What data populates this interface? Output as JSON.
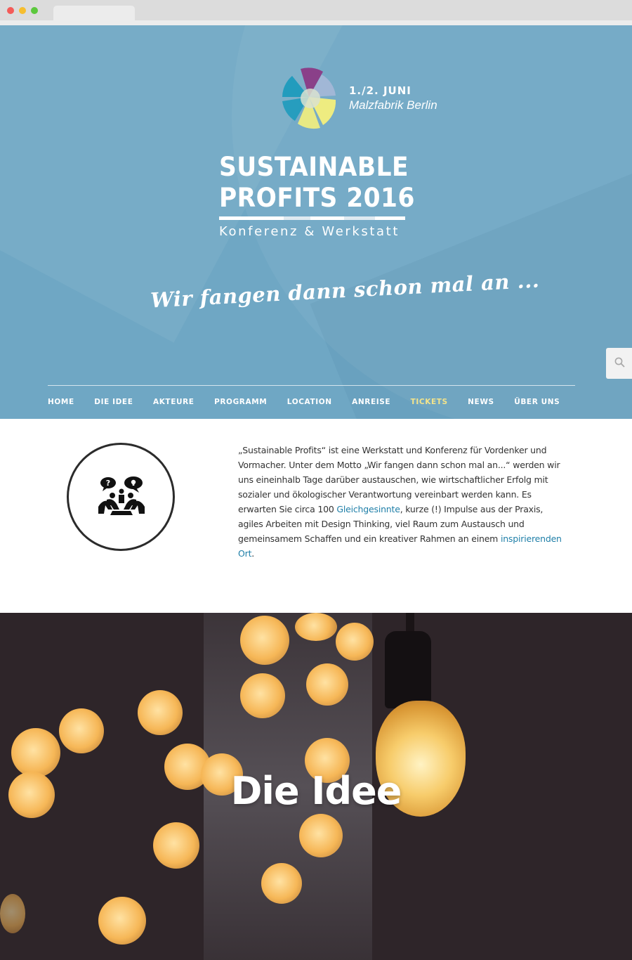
{
  "hero": {
    "date": "1./2. JUNI",
    "venue": "Malzfabrik Berlin",
    "title_line1": "SUSTAINABLE",
    "title_line2": "PROFITS 2016",
    "subtitle": "Konferenz & Werkstatt",
    "motto": "Wir fangen dann schon mal an ...",
    "colors": {
      "background": "#6fa7c4",
      "logo_purple": "#8b3a86",
      "logo_teal": "#1e9bbd",
      "logo_yellow": "#f4ef7c"
    }
  },
  "search": {
    "icon": "search-icon"
  },
  "nav": {
    "items": [
      {
        "label": "HOME"
      },
      {
        "label": "DIE IDEE"
      },
      {
        "label": "AKTEURE"
      },
      {
        "label": "PROGRAMM"
      },
      {
        "label": "LOCATION"
      },
      {
        "label": "ANREISE"
      },
      {
        "label": "TICKETS",
        "active": true
      },
      {
        "label": "NEWS"
      },
      {
        "label": "ÜBER UNS"
      }
    ],
    "active_color": "#f3e48b"
  },
  "intro": {
    "icon": "people-discussion-icon",
    "text_part1": "„Sustainable Profits“ ist eine Werkstatt und Konferenz für Vordenker und Vormacher. Unter dem Motto „Wir fangen dann schon mal an...“ werden wir uns eineinhalb Tage darüber austauschen, wie wirtschaftlicher Erfolg mit sozialer und ökologischer Verantwortung vereinbart werden kann. Es erwarten Sie circa 100 ",
    "link1": "Gleichgesinnte",
    "text_part2": ", kurze (!) Impulse aus der Praxis, agiles Arbeiten mit Design Thinking, viel Raum zum Austausch und gemeinsamem Schaffen und ein kreativer Rahmen an einem ",
    "link2": "inspirierenden Ort",
    "text_part3": ".",
    "link_color": "#1f7fa8"
  },
  "idea": {
    "title": "Die Idee"
  }
}
